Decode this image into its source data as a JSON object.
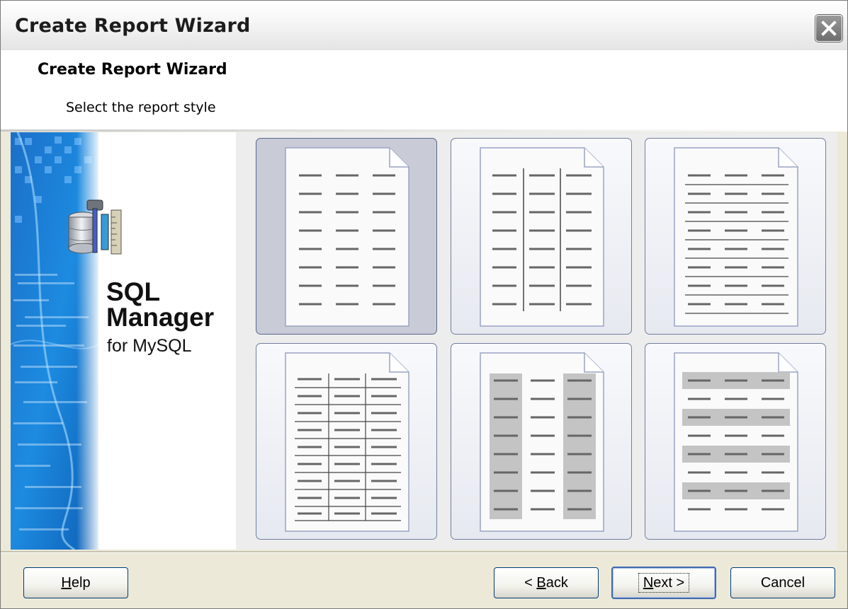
{
  "window": {
    "title": "Create Report Wizard"
  },
  "header": {
    "title": "Create Report Wizard",
    "subtitle": "Select the report style"
  },
  "banner": {
    "brand_line1": "SQL",
    "brand_line2": "Manager",
    "brand_line3": "for MySQL"
  },
  "styles": [
    {
      "name": "plain-columns",
      "selected": true
    },
    {
      "name": "vertical-lines",
      "selected": false
    },
    {
      "name": "horizontal-lines",
      "selected": false
    },
    {
      "name": "full-grid",
      "selected": false
    },
    {
      "name": "shaded-columns",
      "selected": false
    },
    {
      "name": "shaded-rows",
      "selected": false
    }
  ],
  "footer": {
    "help_label": "Help",
    "help_hotkey": "H",
    "back_label": "< Back",
    "back_hotkey": "B",
    "next_label": "Next >",
    "next_hotkey": "N",
    "cancel_label": "Cancel"
  },
  "colors": {
    "selected_card": "#c9cbd6",
    "card_border": "#6f7f9f",
    "button_border": "#003c74",
    "default_button_border": "#4169b0"
  }
}
